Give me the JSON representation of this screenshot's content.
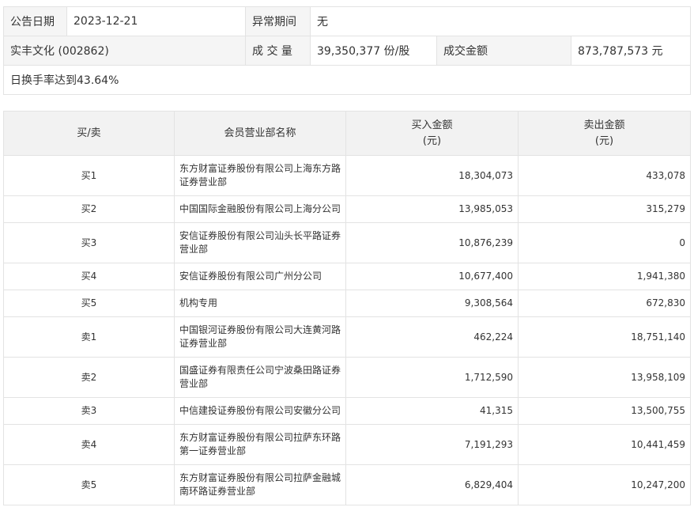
{
  "info": {
    "date_label": "公告日期",
    "date_value": "2023-12-21",
    "abnormal_label": "异常期间",
    "abnormal_value": "无",
    "stock": "实丰文化 (002862)",
    "volume_label": "成 交 量",
    "volume_value": "39,350,377 份/股",
    "amount_label": "成交金额",
    "amount_value": "873,787,573 元",
    "note": "日换手率达到43.64%"
  },
  "table": {
    "headers": {
      "side": "买/卖",
      "name": "会员营业部名称",
      "buy_line1": "买入金额",
      "buy_line2": "(元)",
      "sell_line1": "卖出金额",
      "sell_line2": "(元)"
    },
    "rows": [
      {
        "side": "买1",
        "name_line1": "东方财富证券股份有限公司上海东方路",
        "name_line2": "证券营业部",
        "buy": "18,304,073",
        "sell": "433,078"
      },
      {
        "side": "买2",
        "name_line1": "中国国际金融股份有限公司上海分公司",
        "name_line2": "",
        "buy": "13,985,053",
        "sell": "315,279"
      },
      {
        "side": "买3",
        "name_line1": "安信证券股份有限公司汕头长平路证券",
        "name_line2": "营业部",
        "buy": "10,876,239",
        "sell": "0"
      },
      {
        "side": "买4",
        "name_line1": "安信证券股份有限公司广州分公司",
        "name_line2": "",
        "buy": "10,677,400",
        "sell": "1,941,380"
      },
      {
        "side": "买5",
        "name_line1": "机构专用",
        "name_line2": "",
        "buy": "9,308,564",
        "sell": "672,830"
      },
      {
        "side": "卖1",
        "name_line1": "中国银河证券股份有限公司大连黄河路",
        "name_line2": "证券营业部",
        "buy": "462,224",
        "sell": "18,751,140"
      },
      {
        "side": "卖2",
        "name_line1": "国盛证券有限责任公司宁波桑田路证券",
        "name_line2": "营业部",
        "buy": "1,712,590",
        "sell": "13,958,109"
      },
      {
        "side": "卖3",
        "name_line1": "中信建投证券股份有限公司安徽分公司",
        "name_line2": "",
        "buy": "41,315",
        "sell": "13,500,755"
      },
      {
        "side": "卖4",
        "name_line1": "东方财富证券股份有限公司拉萨东环路",
        "name_line2": "第一证券营业部",
        "buy": "7,191,293",
        "sell": "10,441,459"
      },
      {
        "side": "卖5",
        "name_line1": "东方财富证券股份有限公司拉萨金融城",
        "name_line2": "南环路证券营业部",
        "buy": "6,829,404",
        "sell": "10,247,200"
      }
    ]
  }
}
